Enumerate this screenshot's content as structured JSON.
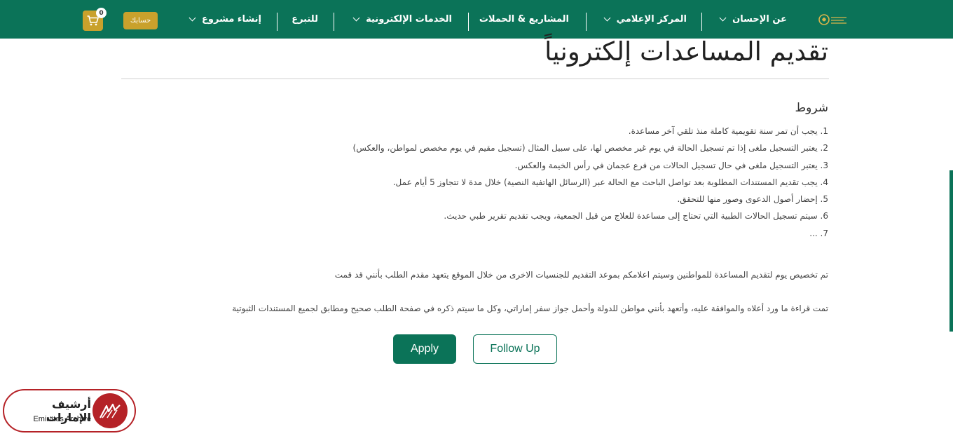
{
  "nav": {
    "items": [
      {
        "label": "عن الإحسان",
        "dropdown": true
      },
      {
        "label": "المركز الإعلامي",
        "dropdown": true
      },
      {
        "label": "المشاريع & الحملات",
        "dropdown": false
      },
      {
        "label": "الخدمات الإلكترونية",
        "dropdown": true
      },
      {
        "label": "للتبرع",
        "dropdown": false
      },
      {
        "label": "إنشاء مشروع",
        "dropdown": true
      }
    ],
    "account_label": "حسابك",
    "cart_count": "0"
  },
  "colors": {
    "brand_green": "#0b7358",
    "gold": "#c9a12c",
    "watermark_red": "#b52227"
  },
  "page": {
    "title": "تقديم المساعدات إلكترونياً",
    "terms_heading": "شروط",
    "terms": [
      "1. يجب أن تمر سنة تقويمية كاملة منذ تلقي آخر مساعدة.",
      "2. يعتبر التسجيل ملغى إذا تم تسجيل الحالة في يوم غير مخصص لها، على سبيل المثال (تسجيل مقيم في يوم مخصص لمواطن، والعكس)",
      "3. يعتبر التسجيل ملغى في حال تسجيل الحالات من فرع عجمان في رأس الخيمة والعكس.",
      "4. يجب تقديم المستندات المطلوبة بعد تواصل الباحث مع الحالة عبر (الرسائل الهاتفية النصية) خلال مدة لا تتجاوز 5 أيام عمل.",
      "5. إحضار أصول الدعوى وصور منها للتحقق.",
      "6. سيتم تسجيل الحالات الطبية التي تحتاج إلى مساعدة للعلاج من قبل الجمعية، ويجب تقديم تقرير طبي حديث.",
      "7. ..."
    ],
    "notice": "تم تخصيص يوم لتقديم المساعدة للمواطنين وسيتم اعلامكم بموعد التقديم للجنسيات الاخرى من خلال الموقع يتعهد مقدم الطلب بأنني قد قمت",
    "declaration": "تمت قراءة ما ورد أعلاه والموافقة عليه، وأتعهد بأنني مواطن للدولة وأحمل جواز سفر إماراتي، وكل ما سيتم ذكره في صفحة الطلب صحيح ومطابق لجميع المستندات الثبوتية"
  },
  "buttons": {
    "apply": "Apply",
    "follow_up": "Follow Up"
  },
  "watermark": {
    "arabic": "أرشيف الإمارات",
    "english": "Emirates Archive"
  },
  "icons": {
    "logo": "charity-logo-icon",
    "cart": "cart-icon",
    "chevron": "chevron-down-icon",
    "archive": "archive-logo-icon"
  }
}
